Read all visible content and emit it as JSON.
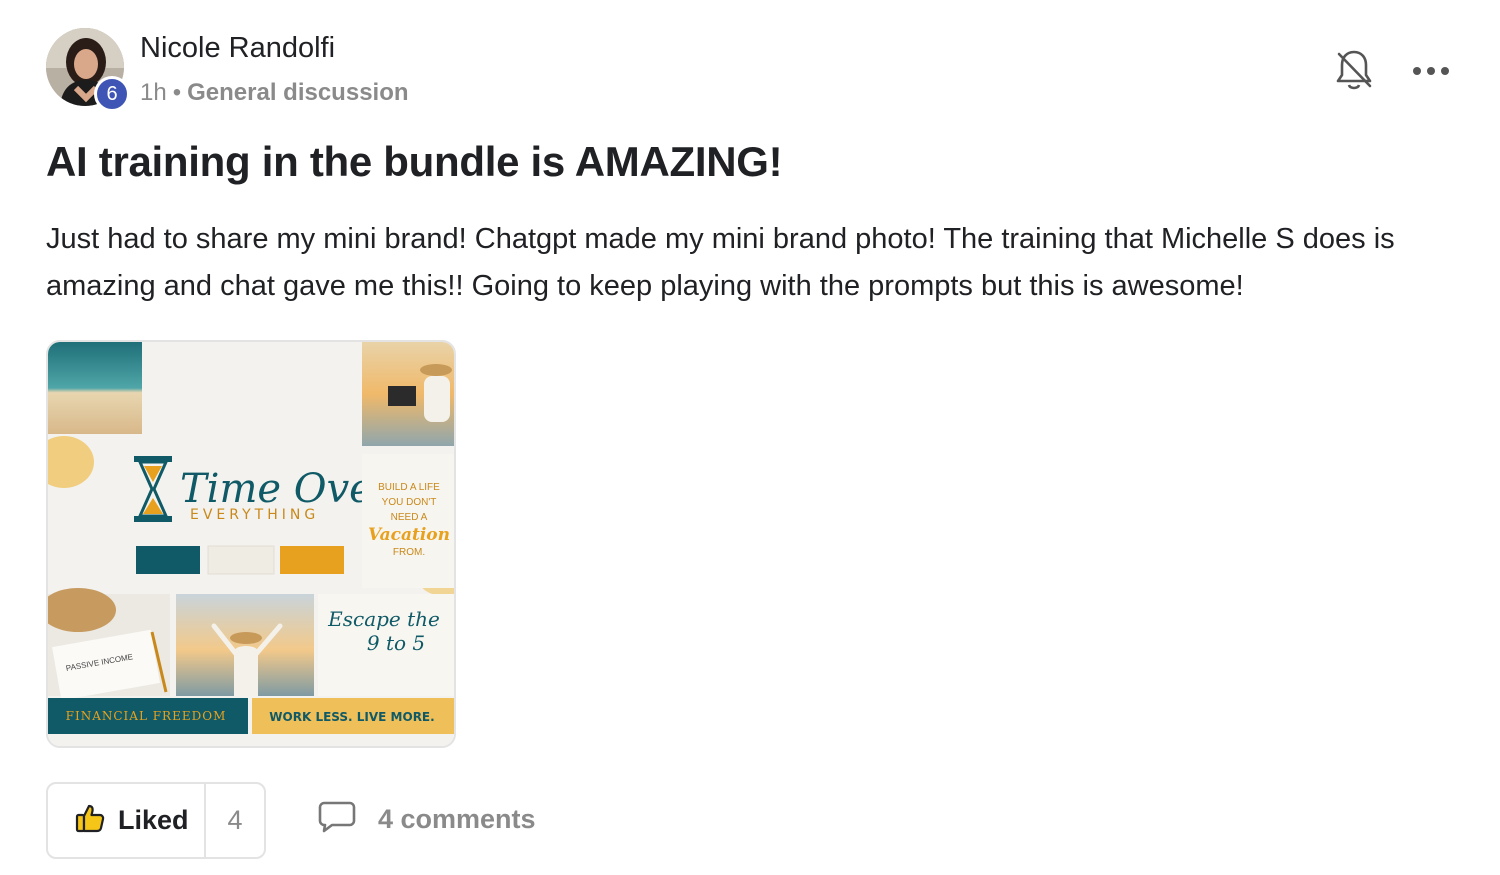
{
  "post": {
    "author": "Nicole Randolfi",
    "level": "6",
    "time": "1h",
    "separator": "•",
    "category": "General discussion",
    "title": "AI training in the bundle is AMAZING!",
    "body": "Just had to share my mini brand! Chatgpt made my mini brand photo! The training that Michelle S does is amazing and chat gave me this!! Going to keep playing with the prompts but this is awesome!"
  },
  "header_icons": {
    "bell": "bell-off-icon",
    "more": "more-horizontal-icon"
  },
  "image": {
    "brand_name": "Time Over",
    "brand_sub": "EVERYTHING",
    "tagline_1": "BUILD A LIFE",
    "tagline_2": "YOU DON'T",
    "tagline_3": "NEED A",
    "tagline_script": "Vacation",
    "tagline_4": "FROM.",
    "paper_text": "PASSIVE INCOME",
    "escape_1": "Escape the",
    "escape_2": "9 to 5",
    "banner_left": "FINANCIAL FREEDOM",
    "banner_right": "WORK LESS. LIVE MORE.",
    "colors": {
      "teal": "#0f5a66",
      "cream": "#f3f1ea",
      "gold": "#e8a11e"
    }
  },
  "footer": {
    "liked_label": "Liked",
    "like_count": "4",
    "comments_label": "4 comments",
    "like_icon": "thumbs-up-icon",
    "comment_icon": "comment-icon"
  }
}
